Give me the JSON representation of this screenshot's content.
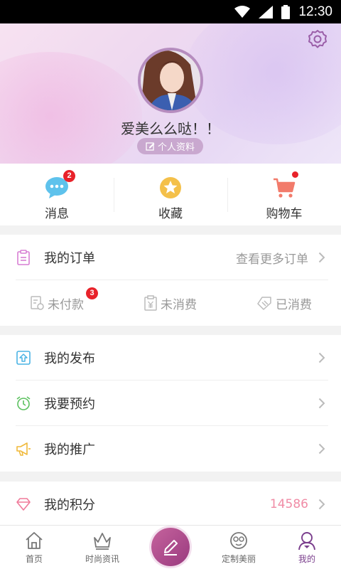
{
  "status_bar": {
    "time": "12:30"
  },
  "profile": {
    "username": "爱美么么哒！！",
    "edit_label": "个人资料"
  },
  "quick_actions": [
    {
      "label": "消息",
      "badge": "2",
      "icon": "message-icon"
    },
    {
      "label": "收藏",
      "icon": "star-icon"
    },
    {
      "label": "购物车",
      "icon": "cart-icon",
      "dot": true
    }
  ],
  "orders": {
    "title": "我的订单",
    "more": "查看更多订单",
    "statuses": [
      {
        "label": "未付款",
        "badge": "3",
        "icon": "unpaid-icon"
      },
      {
        "label": "未消费",
        "icon": "unconsumed-icon"
      },
      {
        "label": "已消费",
        "icon": "consumed-icon"
      }
    ]
  },
  "menu": {
    "publish": "我的发布",
    "reserve": "我要预约",
    "promote": "我的推广",
    "points": "我的积分",
    "points_value": "14586"
  },
  "tabbar": [
    {
      "label": "首页",
      "icon": "home-icon"
    },
    {
      "label": "时尚资讯",
      "icon": "crown-icon"
    },
    {
      "label": "",
      "icon": "pencil-icon"
    },
    {
      "label": "定制美丽",
      "icon": "face-icon"
    },
    {
      "label": "我的",
      "icon": "profile-icon",
      "active": true
    }
  ],
  "colors": {
    "accent": "#7b3f8d",
    "badge": "#e8222a",
    "points": "#f08ca6"
  }
}
